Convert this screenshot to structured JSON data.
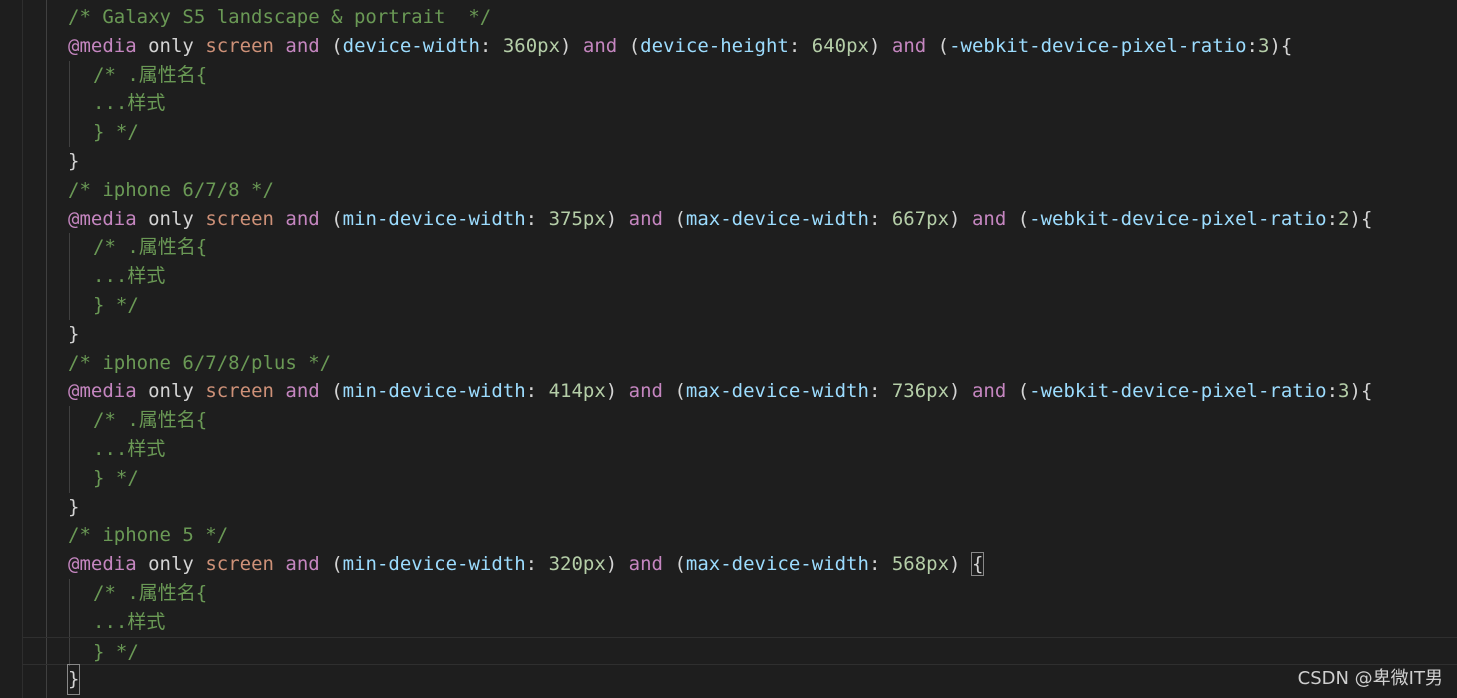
{
  "editor": {
    "watermark": "CSDN @卑微IT男",
    "lines": [
      {
        "comment": "/* Galaxy S5 landscape & portrait  */"
      },
      {
        "media": {
          "at": "@media",
          "only": "only",
          "screen": "screen",
          "and1": "and",
          "q1_open": "(",
          "q1_prop": "device-width",
          "q1_colon": ": ",
          "q1_val": "360px",
          "q1_close": ")",
          "and2": "and",
          "q2_open": "(",
          "q2_prop": "device-height",
          "q2_colon": ": ",
          "q2_val": "640px",
          "q2_close": ")",
          "and3": "and",
          "q3_open": "(",
          "q3_prop": "-webkit-device-pixel-ratio",
          "q3_colon": ":",
          "q3_val": "3",
          "q3_close": ")",
          "brace": "{"
        }
      },
      {
        "comment": "/* .属性名{"
      },
      {
        "comment": "...样式"
      },
      {
        "comment": "} */"
      },
      {
        "brace": "}"
      },
      {
        "comment": "/* iphone 6/7/8 */"
      },
      {
        "media": {
          "at": "@media",
          "only": "only",
          "screen": "screen",
          "and1": "and",
          "q1_open": "(",
          "q1_prop": "min-device-width",
          "q1_colon": ": ",
          "q1_val": "375px",
          "q1_close": ")",
          "and2": "and",
          "q2_open": "(",
          "q2_prop": "max-device-width",
          "q2_colon": ": ",
          "q2_val": "667px",
          "q2_close": ")",
          "and3": "and",
          "q3_open": "(",
          "q3_prop": "-webkit-device-pixel-ratio",
          "q3_colon": ":",
          "q3_val": "2",
          "q3_close": ")",
          "brace": "{"
        }
      },
      {
        "comment": "/* .属性名{"
      },
      {
        "comment": "...样式"
      },
      {
        "comment": "} */"
      },
      {
        "brace": "}"
      },
      {
        "comment": "/* iphone 6/7/8/plus */"
      },
      {
        "media": {
          "at": "@media",
          "only": "only",
          "screen": "screen",
          "and1": "and",
          "q1_open": "(",
          "q1_prop": "min-device-width",
          "q1_colon": ": ",
          "q1_val": "414px",
          "q1_close": ")",
          "and2": "and",
          "q2_open": "(",
          "q2_prop": "max-device-width",
          "q2_colon": ": ",
          "q2_val": "736px",
          "q2_close": ")",
          "and3": "and",
          "q3_open": "(",
          "q3_prop": "-webkit-device-pixel-ratio",
          "q3_colon": ":",
          "q3_val": "3",
          "q3_close": ")",
          "brace": "{"
        }
      },
      {
        "comment": "/* .属性名{"
      },
      {
        "comment": "...样式"
      },
      {
        "comment": "} */"
      },
      {
        "brace": "}"
      },
      {
        "comment": "/* iphone 5 */"
      },
      {
        "media": {
          "at": "@media",
          "only": "only",
          "screen": "screen",
          "and1": "and",
          "q1_open": "(",
          "q1_prop": "min-device-width",
          "q1_colon": ": ",
          "q1_val": "320px",
          "q1_close": ")",
          "and2": "and",
          "q2_open": "(",
          "q2_prop": "max-device-width",
          "q2_colon": ": ",
          "q2_val": "568px",
          "q2_close": ")",
          "brace": "{"
        }
      },
      {
        "comment": "/* .属性名{"
      },
      {
        "comment": "...样式"
      },
      {
        "comment": "} */"
      },
      {
        "brace": "}"
      }
    ]
  }
}
